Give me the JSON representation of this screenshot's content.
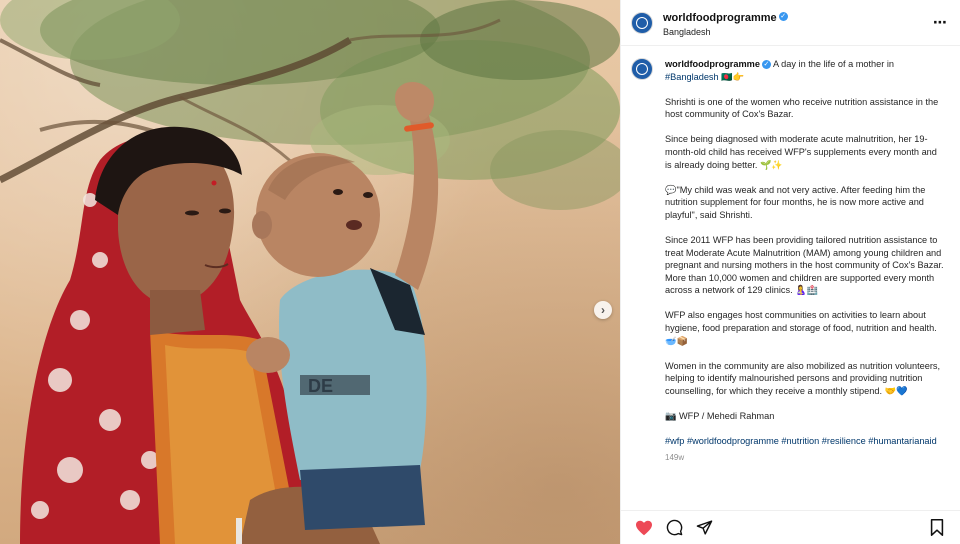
{
  "post": {
    "author": "worldfoodprogramme",
    "location": "Bangladesh",
    "more_icon": "⋯",
    "carousel_next": "›"
  },
  "caption": {
    "author": "worldfoodprogramme",
    "intro": "A day in the life of a mother in",
    "intro_tag": "#Bangladesh",
    "intro_emoji": "🇧🇩👉",
    "p1": "Shrishti is one of the women who receive nutrition assistance in the host community of Cox's Bazar.",
    "p2": "Since being diagnosed with moderate acute malnutrition, her 19-month-old child has received WFP's supplements every month and is already doing better. 🌱✨",
    "p3": "💬\"My child was weak and not very active. After feeding him the nutrition supplement for four months, he is now more active and playful\", said Shrishti.",
    "p4": "Since 2011 WFP has been providing tailored nutrition assistance to treat Moderate Acute Malnutrition (MAM) among young children and pregnant and nursing mothers in the host community of Cox's Bazar. More than 10,000 women and children are supported every month across a network of 129 clinics. 🤱🏥",
    "p5": "WFP also engages host communities on activities to learn about hygiene, food preparation and storage of food, nutrition and health. 🥣📦",
    "p6": "Women in the community are also mobilized as nutrition volunteers, helping to identify malnourished persons and providing nutrition counselling, for which they receive a monthly stipend. 🤝💙",
    "credit": "📷 WFP / Mehedi Rahman",
    "hashtags": "#wfp #worldfoodprogramme #nutrition #resilience #humantarianaid",
    "timestamp": "149w"
  },
  "icons": {
    "like": "heart-icon",
    "comment": "comment-icon",
    "share": "share-icon",
    "save": "bookmark-icon",
    "more": "more-dots-icon",
    "verified": "verified-badge-icon"
  },
  "colors": {
    "like_red": "#ed4956",
    "hashtag_blue": "#00376b",
    "verified_blue": "#3897f0",
    "avatar_blue": "#1f5da8",
    "saree_red": "#c8232c"
  }
}
